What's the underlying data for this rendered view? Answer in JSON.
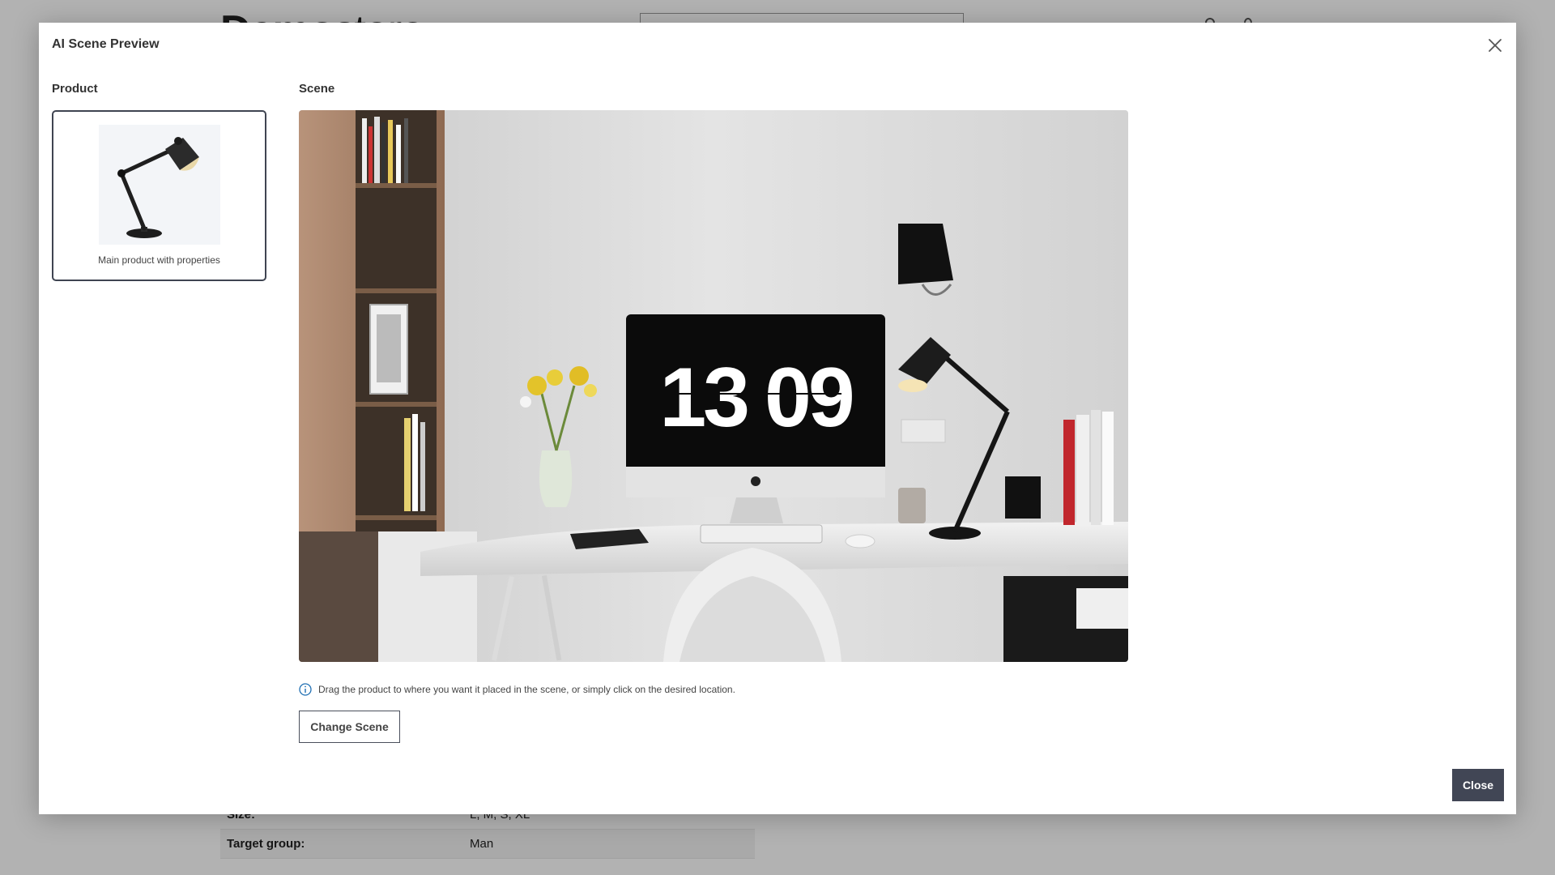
{
  "background": {
    "logo_bold": "Demo",
    "logo_light": "store",
    "properties": [
      {
        "label": "Size:",
        "value": "L, M, S, XL"
      },
      {
        "label": "Target group:",
        "value": "Man"
      }
    ]
  },
  "modal": {
    "title": "AI Scene Preview",
    "product_label": "Product",
    "scene_label": "Scene",
    "product_card": {
      "name": "Main product with properties",
      "icon": "desk-lamp-icon"
    },
    "scene": {
      "clock_hour": "13",
      "clock_minute": "09"
    },
    "hint": "Drag the product to where you want it placed in the scene, or simply click on the desired location.",
    "change_scene_label": "Change Scene",
    "close_label": "Close",
    "accent_color": "#414655"
  }
}
